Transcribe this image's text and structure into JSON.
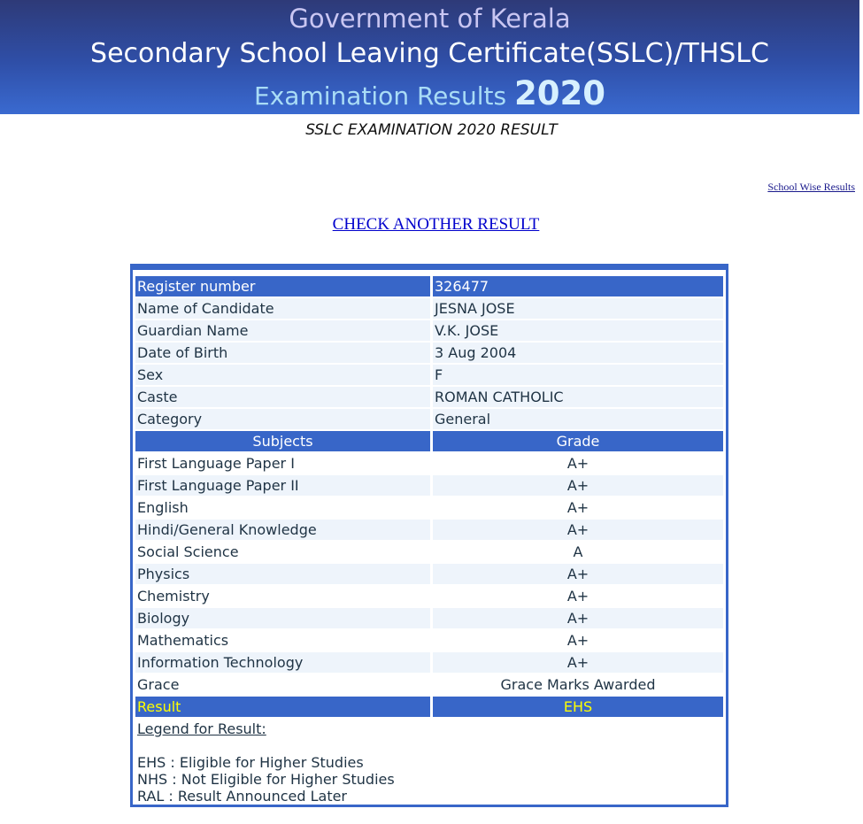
{
  "header": {
    "line1": "Government of Kerala",
    "line2": "Secondary School Leaving Certificate(SSLC)/THSLC",
    "line3_text": "Examination Results ",
    "line3_year": "2020"
  },
  "subtitle": "SSLC EXAMINATION 2020 RESULT",
  "links": {
    "school_wise": "School Wise Results",
    "check_another": "CHECK ANOTHER RESULT "
  },
  "candidate": [
    {
      "label": "Register number",
      "value": "326477"
    },
    {
      "label": "Name of Candidate",
      "value": "JESNA JOSE"
    },
    {
      "label": "Guardian Name",
      "value": "V.K. JOSE"
    },
    {
      "label": "Date of Birth",
      "value": "3 Aug 2004"
    },
    {
      "label": "Sex",
      "value": "F"
    },
    {
      "label": "Caste",
      "value": "ROMAN CATHOLIC"
    },
    {
      "label": "Category",
      "value": "General"
    }
  ],
  "grades_header": {
    "subjects": "Subjects",
    "grade": "Grade"
  },
  "grades": [
    {
      "subject": "First Language Paper I",
      "grade": "A+"
    },
    {
      "subject": "First Language Paper II",
      "grade": "A+"
    },
    {
      "subject": "English",
      "grade": "A+"
    },
    {
      "subject": "Hindi/General Knowledge",
      "grade": "A+"
    },
    {
      "subject": "Social Science",
      "grade": "A"
    },
    {
      "subject": "Physics",
      "grade": "A+"
    },
    {
      "subject": "Chemistry",
      "grade": "A+"
    },
    {
      "subject": "Biology",
      "grade": "A+"
    },
    {
      "subject": "Mathematics",
      "grade": "A+"
    },
    {
      "subject": "Information Technology",
      "grade": "A+"
    },
    {
      "subject": "Grace",
      "grade": "Grace Marks Awarded"
    }
  ],
  "result": {
    "label": "Result",
    "value": "EHS"
  },
  "legend": {
    "title": "Legend for Result:",
    "items": [
      "EHS : Eligible for Higher Studies",
      "NHS : Not Eligible for Higher Studies",
      "RAL : Result Announced Later"
    ]
  },
  "colors": {
    "accent_blue": "#3866c8",
    "row_light": "#eef4fb",
    "result_yellow": "#ffff00"
  }
}
